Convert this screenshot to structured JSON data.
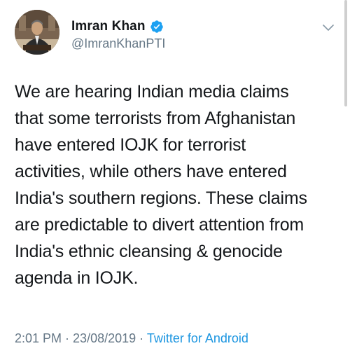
{
  "tweet": {
    "author": {
      "display_name": "Imran Khan",
      "handle": "@ImranKhanPTI",
      "verified": true
    },
    "text_lines": [
      "We are hearing Indian media claims",
      "that some terrorists from Afghanistan",
      "have entered IOJK for terrorist",
      "activities, while others have entered",
      "India's southern regions. These claims",
      "are predictable to divert attention from",
      "India's ethnic cleansing & genocide",
      "agenda in IOJK."
    ],
    "time": "2:01 PM",
    "separator": " · ",
    "date": "23/08/2019",
    "source": "Twitter for Android"
  },
  "icons": {
    "verified": "verified-badge-icon",
    "menu": "chevron-down-icon"
  },
  "colors": {
    "text": "#14171a",
    "secondary": "#657786",
    "link": "#1b95e0",
    "verified": "#1da1f2"
  }
}
